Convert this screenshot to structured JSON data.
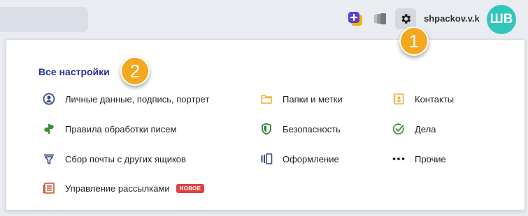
{
  "header": {
    "username": "shpackov.v.k",
    "avatar_initials": "ШВ",
    "icons": [
      "plus-square-icon",
      "cards-icon",
      "gear-icon"
    ]
  },
  "markers": {
    "one": "1",
    "two": "2"
  },
  "settings": {
    "title": "Все настройки",
    "col1": [
      {
        "label": "Личные данные, подпись, портрет",
        "icon": "person-icon"
      },
      {
        "label": "Правила обработки писем",
        "icon": "filter-rules-icon"
      },
      {
        "label": "Сбор почты с других ящиков",
        "icon": "funnel-icon"
      },
      {
        "label": "Управление рассылками",
        "icon": "newsletter-icon",
        "badge": "НОВОЕ"
      }
    ],
    "col2": [
      {
        "label": "Папки и метки",
        "icon": "folder-icon"
      },
      {
        "label": "Безопасность",
        "icon": "shield-icon"
      },
      {
        "label": "Оформление",
        "icon": "theme-icon"
      }
    ],
    "col3": [
      {
        "label": "Контакты",
        "icon": "contacts-icon"
      },
      {
        "label": "Дела",
        "icon": "check-circle-icon"
      },
      {
        "label": "Прочие",
        "icon": "more-dots-icon"
      }
    ]
  },
  "colors": {
    "accent": "#24329b",
    "marker": "#f4a81f",
    "avatar": "#30c6bc",
    "badge": "#e04040"
  }
}
